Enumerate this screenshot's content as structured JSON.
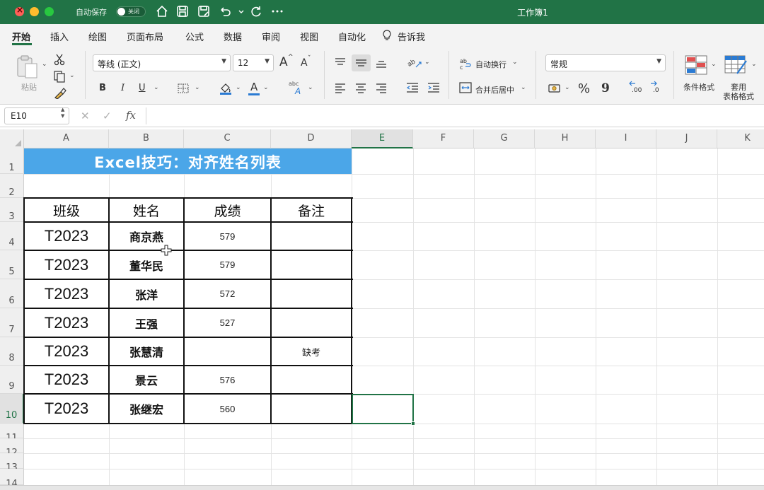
{
  "window": {
    "title": "工作簿1",
    "autosave_label": "自动保存",
    "autosave_state": "关闭"
  },
  "ribbon_tabs": [
    "开始",
    "插入",
    "绘图",
    "页面布局",
    "公式",
    "数据",
    "审阅",
    "视图",
    "自动化",
    "告诉我"
  ],
  "ribbon": {
    "paste_label": "粘贴",
    "font_name": "等线 (正文)",
    "font_size": "12",
    "bold": "B",
    "italic": "I",
    "underline": "U",
    "wrap_text": "自动换行",
    "merge_center": "合并后居中",
    "number_format": "常规",
    "percent": "%",
    "comma": "9",
    "increase_decimal": ".00",
    "decrease_decimal": ".0",
    "conditional_format": "条件格式",
    "table_format_line1": "套用",
    "table_format_line2": "表格格式",
    "grow_font": "A",
    "shrink_font": "A",
    "font_color": "A"
  },
  "formula_bar": {
    "name_box": "E10",
    "fx": "fx",
    "cancel": "✕",
    "enter": "✓",
    "value": ""
  },
  "columns": [
    "A",
    "B",
    "C",
    "D",
    "E",
    "F",
    "G",
    "H",
    "I",
    "J",
    "K"
  ],
  "selected_column": "E",
  "rows": [
    "1",
    "2",
    "3",
    "4",
    "5",
    "6",
    "7",
    "8",
    "9",
    "10",
    "11",
    "12",
    "13",
    "14"
  ],
  "selected_row": "10",
  "sheet": {
    "title": "Excel技巧：对齐姓名列表",
    "headers": [
      "班级",
      "姓名",
      "成绩",
      "备注"
    ],
    "records": [
      {
        "class": "T2023",
        "name": "商京燕",
        "score": "579",
        "note": ""
      },
      {
        "class": "T2023",
        "name": "董华民",
        "score": "579",
        "note": ""
      },
      {
        "class": "T2023",
        "name": "张洋",
        "score": "572",
        "note": ""
      },
      {
        "class": "T2023",
        "name": "王强",
        "score": "527",
        "note": ""
      },
      {
        "class": "T2023",
        "name": "张慧清",
        "score": "",
        "note": "缺考"
      },
      {
        "class": "T2023",
        "name": "景云",
        "score": "576",
        "note": ""
      },
      {
        "class": "T2023",
        "name": "张继宏",
        "score": "560",
        "note": ""
      }
    ]
  },
  "colors": {
    "excel_green": "#217346",
    "title_fill": "#4ba6e8"
  }
}
